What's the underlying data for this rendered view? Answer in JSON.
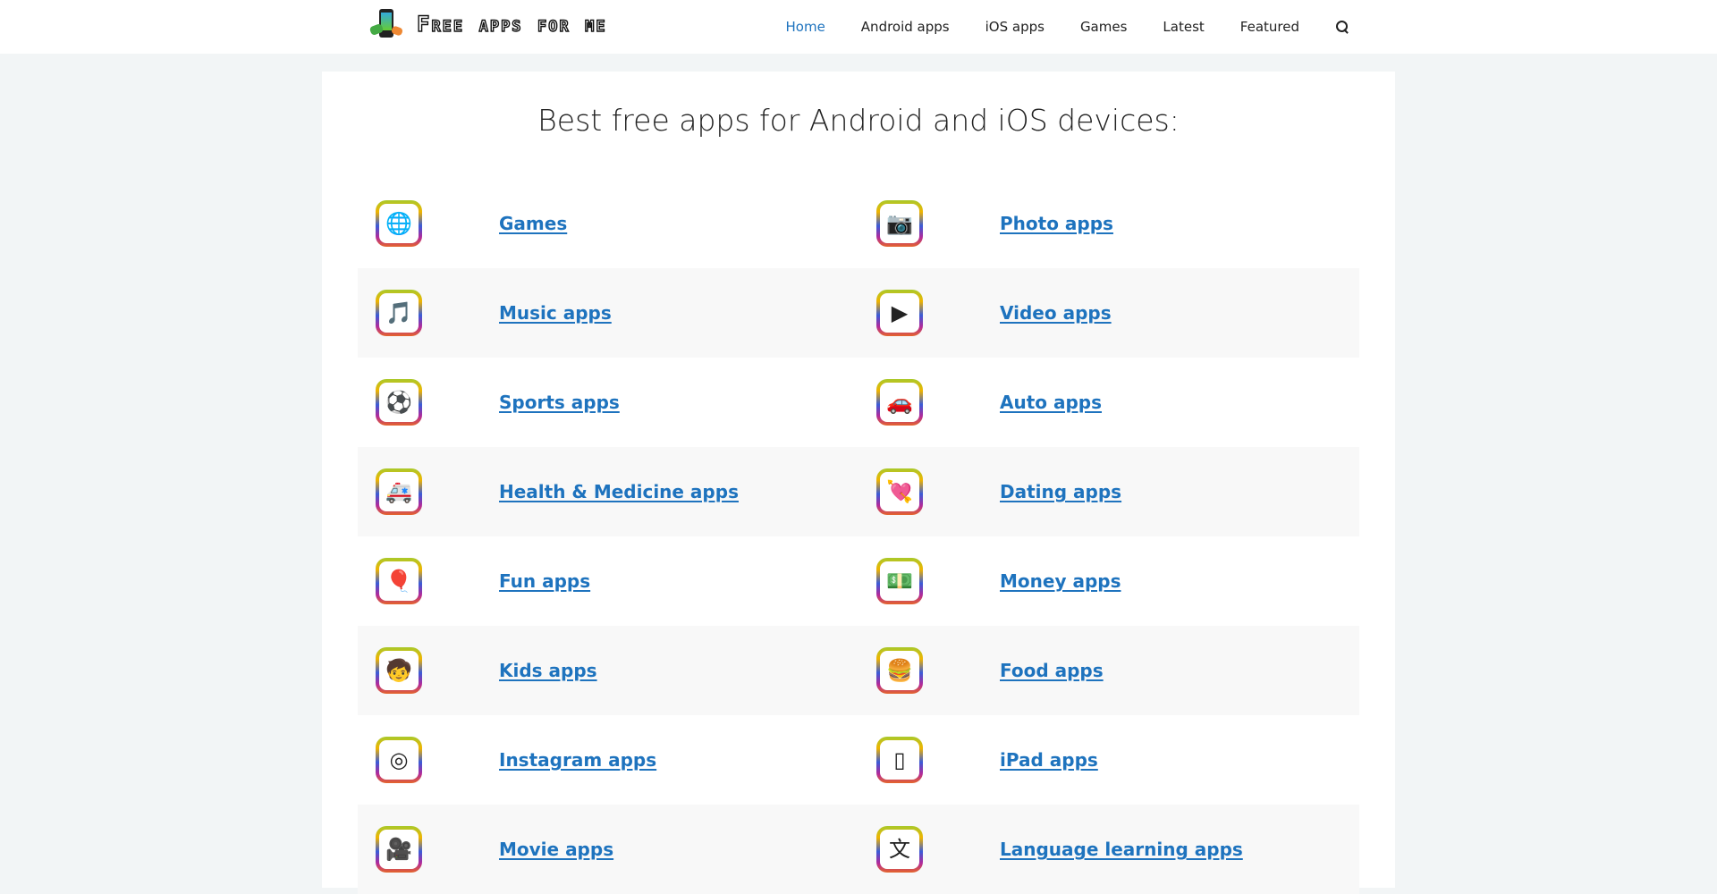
{
  "header": {
    "logo_text": "Free apps for me",
    "nav": [
      {
        "label": "Home",
        "active": true
      },
      {
        "label": "Android apps"
      },
      {
        "label": "iOS apps"
      },
      {
        "label": "Games"
      },
      {
        "label": "Latest"
      },
      {
        "label": "Featured"
      }
    ],
    "search_icon": "search-icon"
  },
  "main": {
    "title": "Best free apps for Android and iOS devices:",
    "categories": [
      {
        "label": "Games",
        "icon": "globe-gamepad-icon",
        "glyph": "🌐"
      },
      {
        "label": "Photo apps",
        "icon": "camera-icon",
        "glyph": "📷"
      },
      {
        "label": "Music apps",
        "icon": "music-notes-icon",
        "glyph": "🎵"
      },
      {
        "label": "Video apps",
        "icon": "video-play-icon",
        "glyph": "▶"
      },
      {
        "label": "Sports apps",
        "icon": "calendar-ball-icon",
        "glyph": "⚽"
      },
      {
        "label": "Auto apps",
        "icon": "car-icon",
        "glyph": "🚗"
      },
      {
        "label": "Health & Medicine apps",
        "icon": "ambulance-icon",
        "glyph": "🚑"
      },
      {
        "label": "Dating apps",
        "icon": "heart-arrow-icon",
        "glyph": "💘"
      },
      {
        "label": "Fun apps",
        "icon": "balloons-icon",
        "glyph": "🎈"
      },
      {
        "label": "Money apps",
        "icon": "money-icon",
        "glyph": "💵"
      },
      {
        "label": "Kids apps",
        "icon": "kids-icon",
        "glyph": "🧒"
      },
      {
        "label": "Food apps",
        "icon": "burger-icon",
        "glyph": "🍔"
      },
      {
        "label": "Instagram apps",
        "icon": "instagram-icon",
        "glyph": "◎"
      },
      {
        "label": "iPad apps",
        "icon": "ipad-icon",
        "glyph": "▯"
      },
      {
        "label": "Movie apps",
        "icon": "movie-camera-icon",
        "glyph": "🎥"
      },
      {
        "label": "Language learning apps",
        "icon": "translate-icon",
        "glyph": "文"
      }
    ]
  },
  "colors": {
    "link": "#1e73be",
    "background": "#f2f5f6",
    "row_alt": "#f8f8f8"
  }
}
